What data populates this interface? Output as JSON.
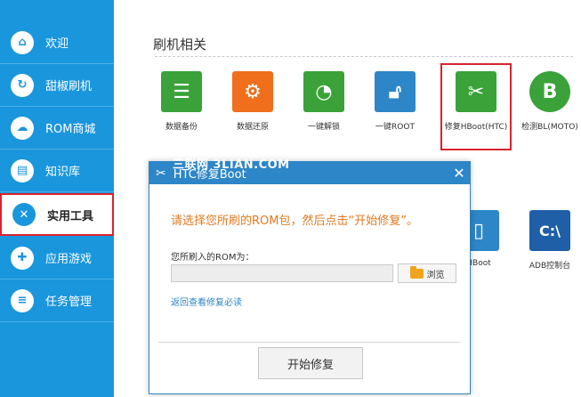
{
  "sidebar": {
    "items": [
      {
        "label": "欢迎",
        "icon": "home-icon"
      },
      {
        "label": "甜椒刷机",
        "icon": "refresh-icon"
      },
      {
        "label": "ROM商城",
        "icon": "cloud-download-icon"
      },
      {
        "label": "知识库",
        "icon": "book-icon"
      },
      {
        "label": "实用工具",
        "icon": "tools-icon",
        "active": true
      },
      {
        "label": "应用游戏",
        "icon": "gamepad-icon"
      },
      {
        "label": "任务管理",
        "icon": "list-icon"
      }
    ]
  },
  "main": {
    "section_title": "刷机相关",
    "tools": [
      {
        "label": "数据备份",
        "icon": "document-icon",
        "color": "#3aa239"
      },
      {
        "label": "数据还原",
        "icon": "gear-icon",
        "color": "#ef6f1c"
      },
      {
        "label": "一键解锁",
        "icon": "unlock-circle-icon",
        "color": "#3aa239"
      },
      {
        "label": "一键ROOT",
        "icon": "padlock-icon",
        "color": "#2d86c7"
      },
      {
        "label": "修复HBoot(HTC)",
        "icon": "tools-icon",
        "color": "#3aa239",
        "selected": true
      },
      {
        "label": "检测BL(MOTO)",
        "icon": "moto-icon",
        "color": "#3aa239"
      }
    ],
    "second_row": [
      {
        "label": "HBoot",
        "icon": "phone-icon",
        "color": "#2d86c7"
      },
      {
        "label": "ADB控制台",
        "icon": "console-icon",
        "color": "#2d86c7",
        "glyph": "C:\\"
      }
    ]
  },
  "dialog": {
    "title": "HTC修复Boot",
    "watermark": "三联网 3LIAN.COM",
    "prompt": "请选择您所刷的ROM包，然后点击“开始修复”。",
    "rom_label": "您所刷入的ROM为：",
    "rom_value": "",
    "browse_label": "浏览",
    "back_link": "返回查看修复必读",
    "start_label": "开始修复"
  },
  "colors": {
    "sidebar": "#1a96dc",
    "dialog_title": "#2d86c7",
    "accent_orange": "#e07a20",
    "highlight_red": "#d9232e"
  }
}
